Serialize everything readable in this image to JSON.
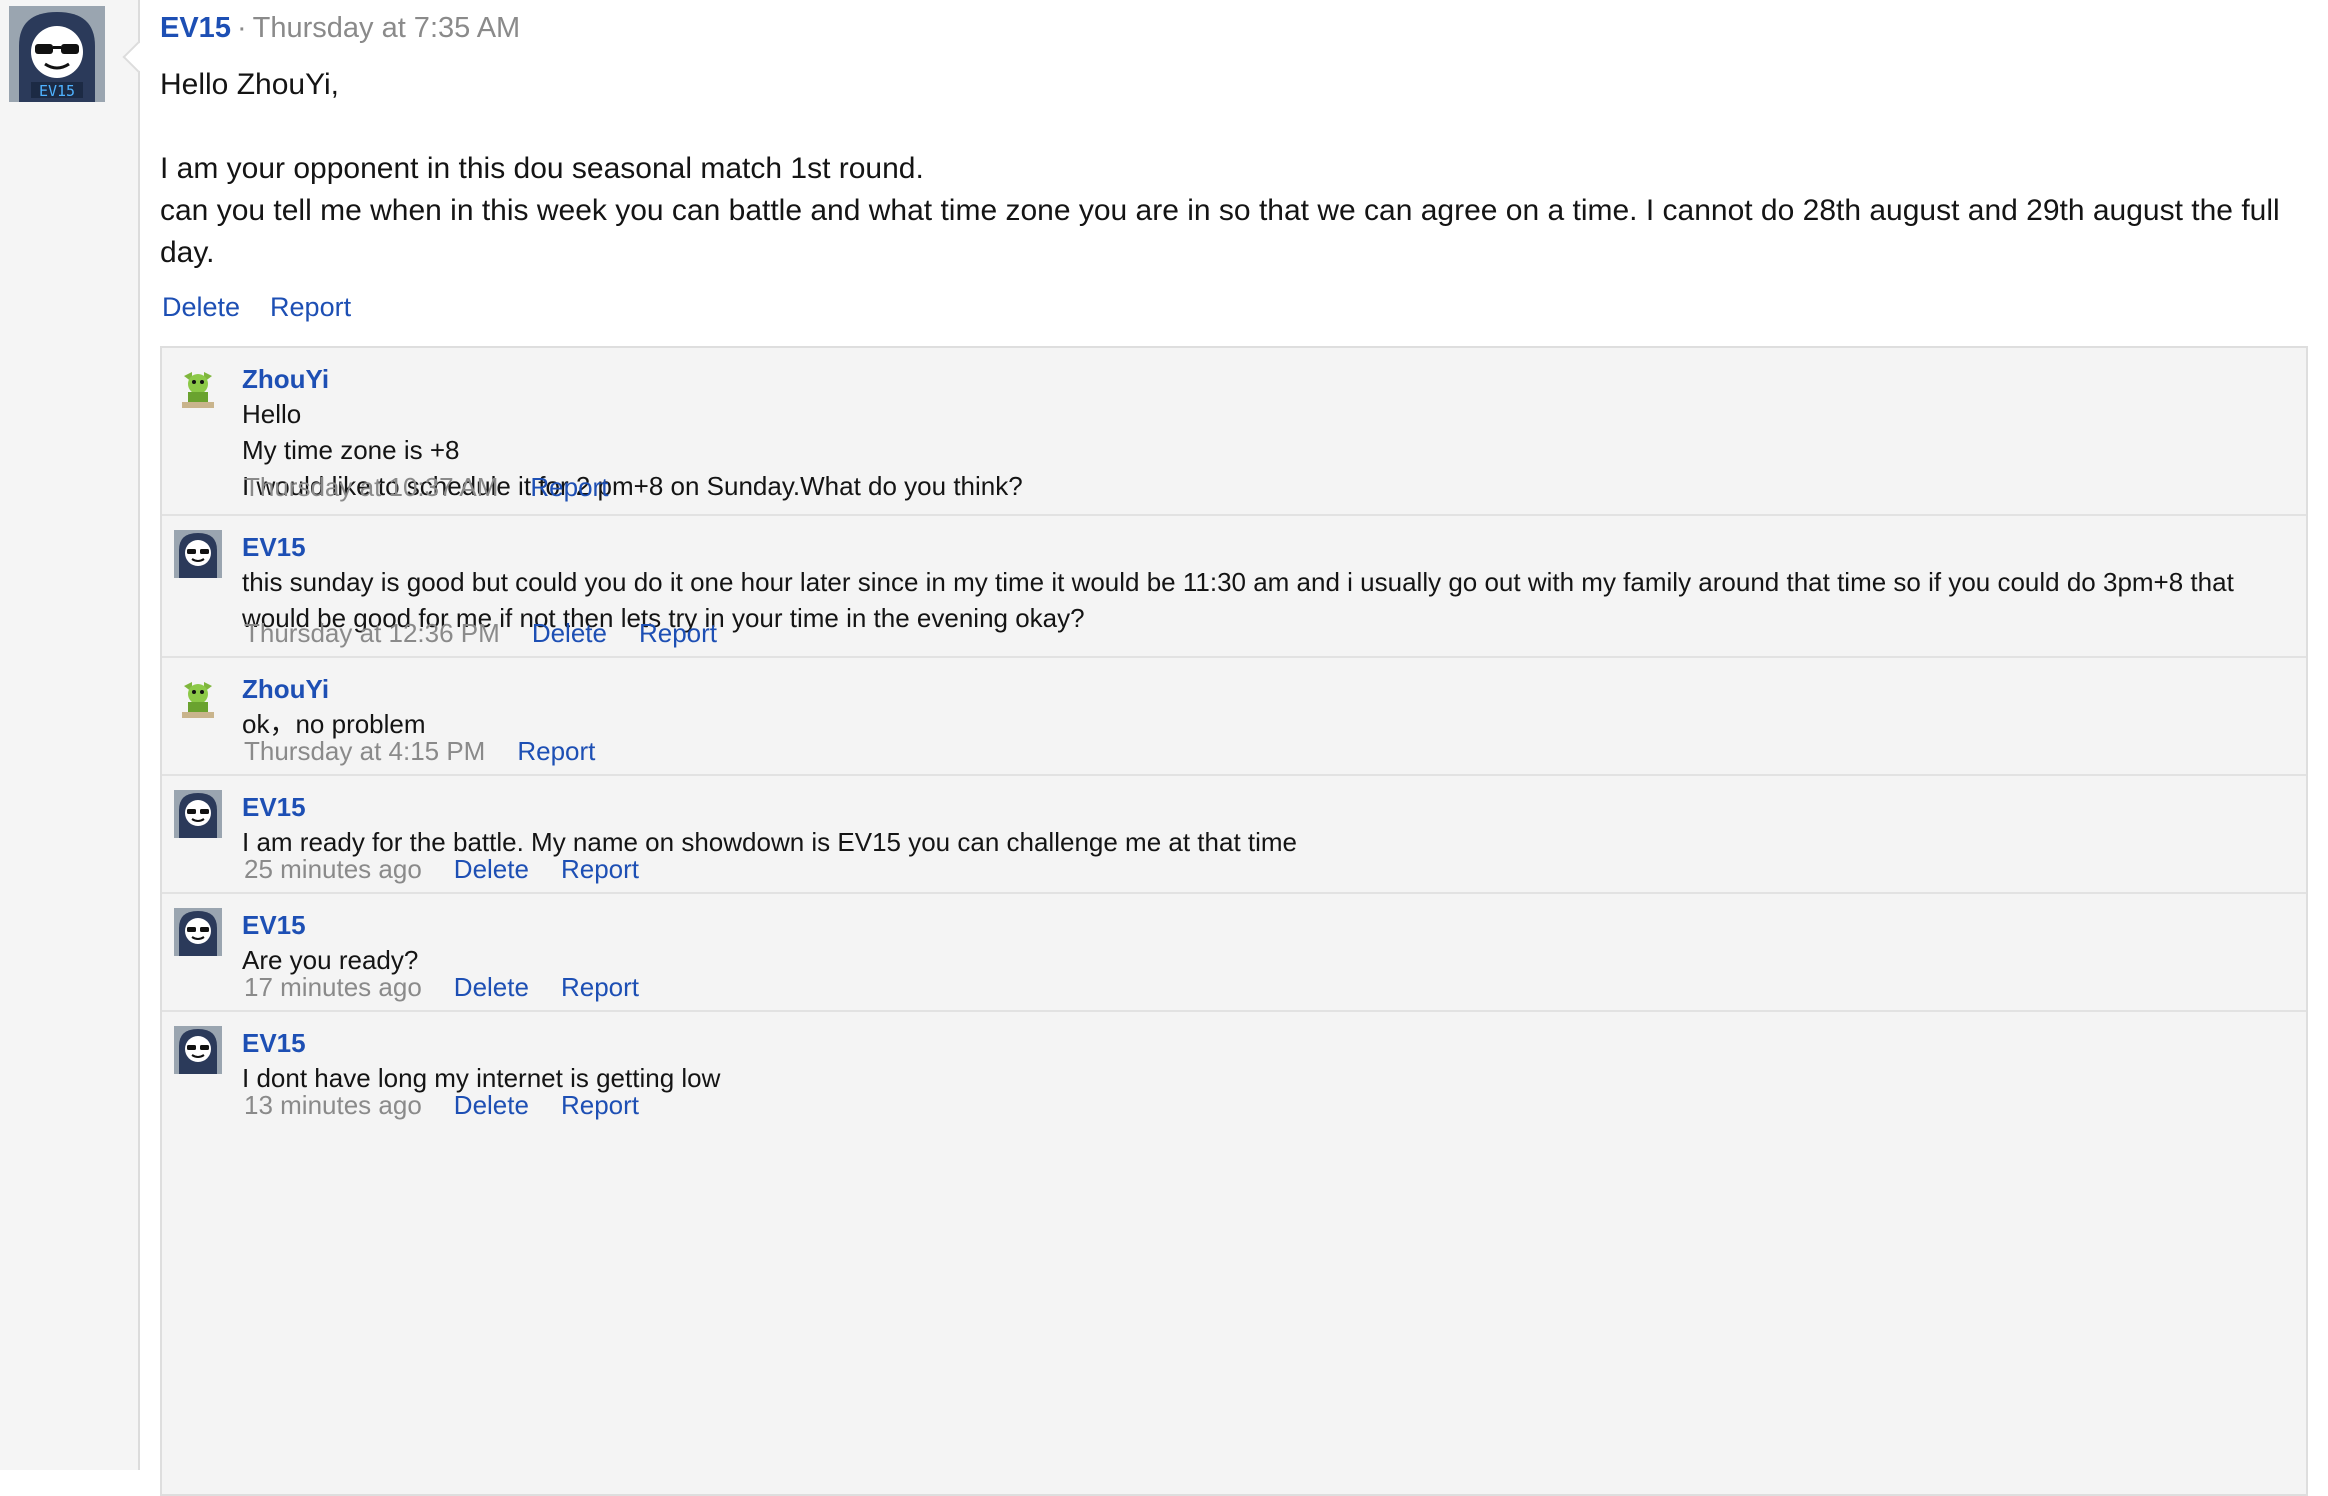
{
  "main_post": {
    "author": "EV15",
    "separator": "·",
    "timestamp": "Thursday at 7:35 AM",
    "lines": [
      "Hello ZhouYi,",
      "I am your opponent in this dou seasonal match 1st round.",
      "can you tell me when in this week you can battle and what time zone you are in so that we can agree on a time. I cannot do 28th august and 29th august the full day."
    ],
    "delete_label": "Delete",
    "report_label": "Report",
    "avatar_text": "EV15"
  },
  "replies": [
    {
      "author": "ZhouYi",
      "lines": [
        "Hello",
        "My time zone is +8",
        "I would like to schedule it for 2 pm+8 on Sunday.What do you think?"
      ],
      "timestamp": "Thursday at 10:37 AM",
      "delete_label": "",
      "report_label": "Report"
    },
    {
      "author": "EV15",
      "lines": [
        "this sunday is good but could you do it one hour later since in my time it would be 11:30 am and i usually go out with my family around that time so if you could do 3pm+8 that would be good for me if not then lets try in your time in the evening okay?"
      ],
      "timestamp": "Thursday at 12:36 PM",
      "delete_label": "Delete",
      "report_label": "Report"
    },
    {
      "author": "ZhouYi",
      "lines": [
        "ok，no problem"
      ],
      "timestamp": "Thursday at 4:15 PM",
      "delete_label": "",
      "report_label": "Report"
    },
    {
      "author": "EV15",
      "lines": [
        "I am ready for the battle. My name on showdown is EV15 you can challenge me at that time"
      ],
      "timestamp": "25 minutes ago",
      "delete_label": "Delete",
      "report_label": "Report"
    },
    {
      "author": "EV15",
      "lines": [
        "Are you ready?"
      ],
      "timestamp": "17 minutes ago",
      "delete_label": "Delete",
      "report_label": "Report"
    },
    {
      "author": "EV15",
      "lines": [
        "I dont have long my internet is getting low"
      ],
      "timestamp": "13 minutes ago",
      "delete_label": "Delete",
      "report_label": "Report"
    }
  ],
  "colors": {
    "link": "#1d4fb4",
    "muted": "#8a8a8a",
    "reply_bg": "#f4f4f4"
  }
}
